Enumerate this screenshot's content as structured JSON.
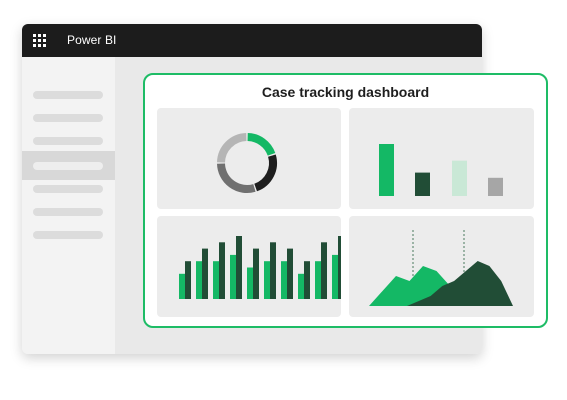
{
  "app": {
    "title": "Power BI"
  },
  "dashboard": {
    "title": "Case tracking dashboard"
  },
  "colors": {
    "green": "#14b865",
    "dark_green": "#214d36",
    "light_green": "#c9e8d6",
    "gray": "#a6a6a6",
    "black": "#1e1e1e",
    "accent_border": "#1ebc66"
  },
  "chart_data": [
    {
      "type": "pie",
      "values": [
        20,
        25,
        30,
        25
      ],
      "colors": [
        "#14b865",
        "#1e1e1e",
        "#707070",
        "#b5b5b5"
      ]
    },
    {
      "type": "bar",
      "values": [
        100,
        45,
        68,
        35
      ],
      "colors": [
        "#14b865",
        "#214d36",
        "#c9e8d6",
        "#a6a6a6"
      ]
    },
    {
      "type": "bar",
      "series": [
        {
          "values": [
            4,
            6,
            6,
            7,
            5,
            6,
            6,
            4,
            6,
            7
          ],
          "color": "#14b865"
        },
        {
          "values": [
            6,
            8,
            9,
            10,
            8,
            9,
            8,
            6,
            9,
            10
          ],
          "color": "#214d36"
        }
      ]
    },
    {
      "type": "area",
      "series": [
        {
          "values": [
            0,
            3,
            6,
            5,
            8,
            7,
            4,
            1,
            0
          ],
          "color": "#14b865"
        },
        {
          "values": [
            0,
            1,
            2,
            4,
            5,
            7,
            9,
            8,
            5,
            0
          ],
          "color": "#214d36"
        }
      ]
    }
  ]
}
